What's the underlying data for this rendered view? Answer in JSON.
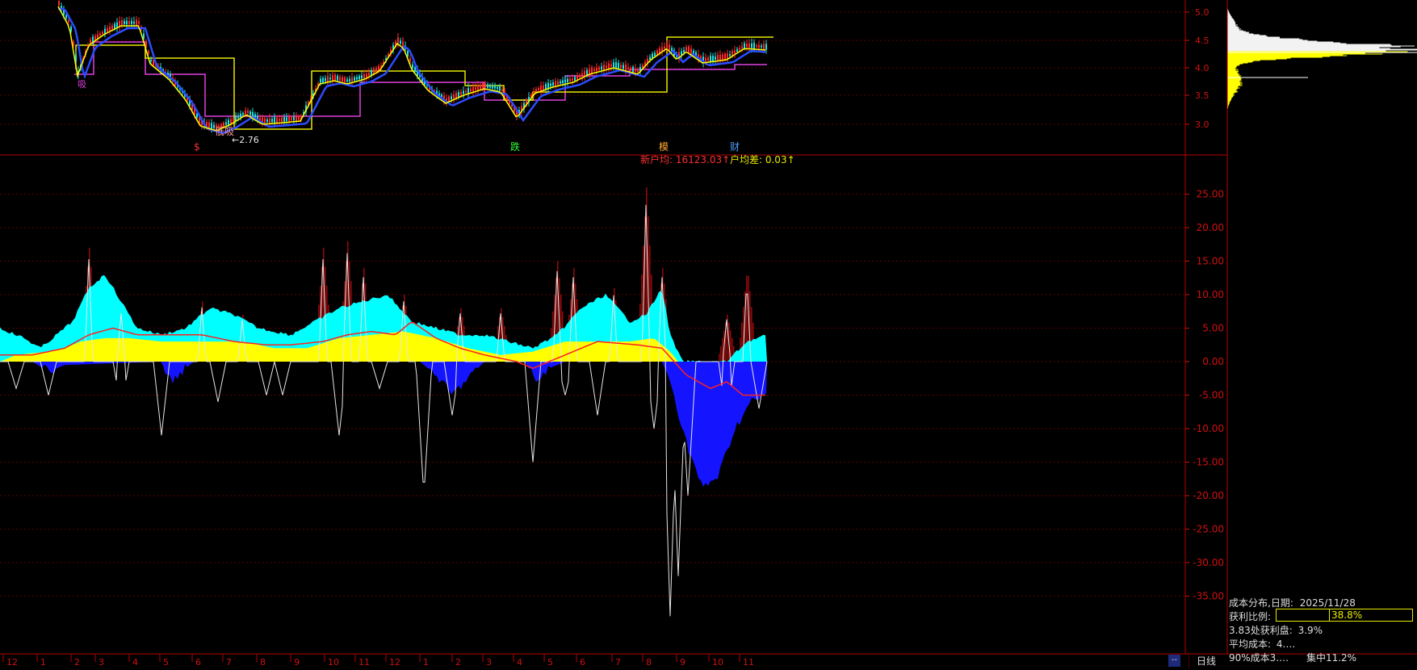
{
  "colors": {
    "background": "#000000",
    "frame": "#b40000",
    "grid": "#5a0000",
    "axis_text": "#d01010",
    "candle_up": "#ff2a2a",
    "candle_down": "#20e0e0",
    "ma_yellow": "#ffff00",
    "ma_blue": "#2a4cff",
    "step_yellow": "#e8e800",
    "step_magenta": "#e040e0",
    "area_yellow": "#ffff00",
    "area_cyan": "#00ffff",
    "area_darkred": "#8b0a0a",
    "area_blue": "#1414ff",
    "line_red": "#ff2020",
    "line_white": "#e6e6e6"
  },
  "price_axis": {
    "ticks": [
      "5.0",
      "4.5",
      "4.0",
      "3.5",
      "3.0"
    ]
  },
  "price_labels": {
    "low_marker": "←2.76",
    "buy_tag": "低吸",
    "left_tag": "吸"
  },
  "signal_markers": [
    {
      "text": "$",
      "color": "#ff3030"
    },
    {
      "text": "跌",
      "color": "#30ff30"
    },
    {
      "text": "模",
      "color": "#ffaa30"
    },
    {
      "text": "财",
      "color": "#4aa0ff"
    }
  ],
  "indicator_header": {
    "household_avg_label": "新户均: 16123.03↑",
    "household_diff_label": "户均差: 0.03↑"
  },
  "indicator_axis": {
    "ticks": [
      "25.00",
      "20.00",
      "15.00",
      "10.00",
      "5.00",
      "0.00",
      "-5.00",
      "-10.00",
      "-15.00",
      "-20.00",
      "-25.00",
      "-30.00",
      "-35.00"
    ]
  },
  "time_axis": {
    "labels": [
      "12",
      "1",
      "2",
      "3",
      "4",
      "5",
      "6",
      "7",
      "8",
      "9",
      "10",
      "11",
      "12",
      "1",
      "2",
      "3",
      "4",
      "5",
      "6",
      "7",
      "8",
      "9",
      "10",
      "11"
    ]
  },
  "period_button": "日线",
  "scroll_button": "--",
  "cost_distribution": {
    "title": "成本分布,日期:",
    "date": "2025/11/28",
    "profit_ratio_label": "获利比例:",
    "profit_ratio_value": "38.8%",
    "profit_ratio": 0.388,
    "profit_at_label": "3.83处获利盘:",
    "profit_at_value": "3.9%",
    "avg_cost_label": "平均成本:",
    "avg_cost_value": "4.…",
    "cost90_label": "90%成本3.…",
    "concentration_label": "集中11.2%"
  }
}
